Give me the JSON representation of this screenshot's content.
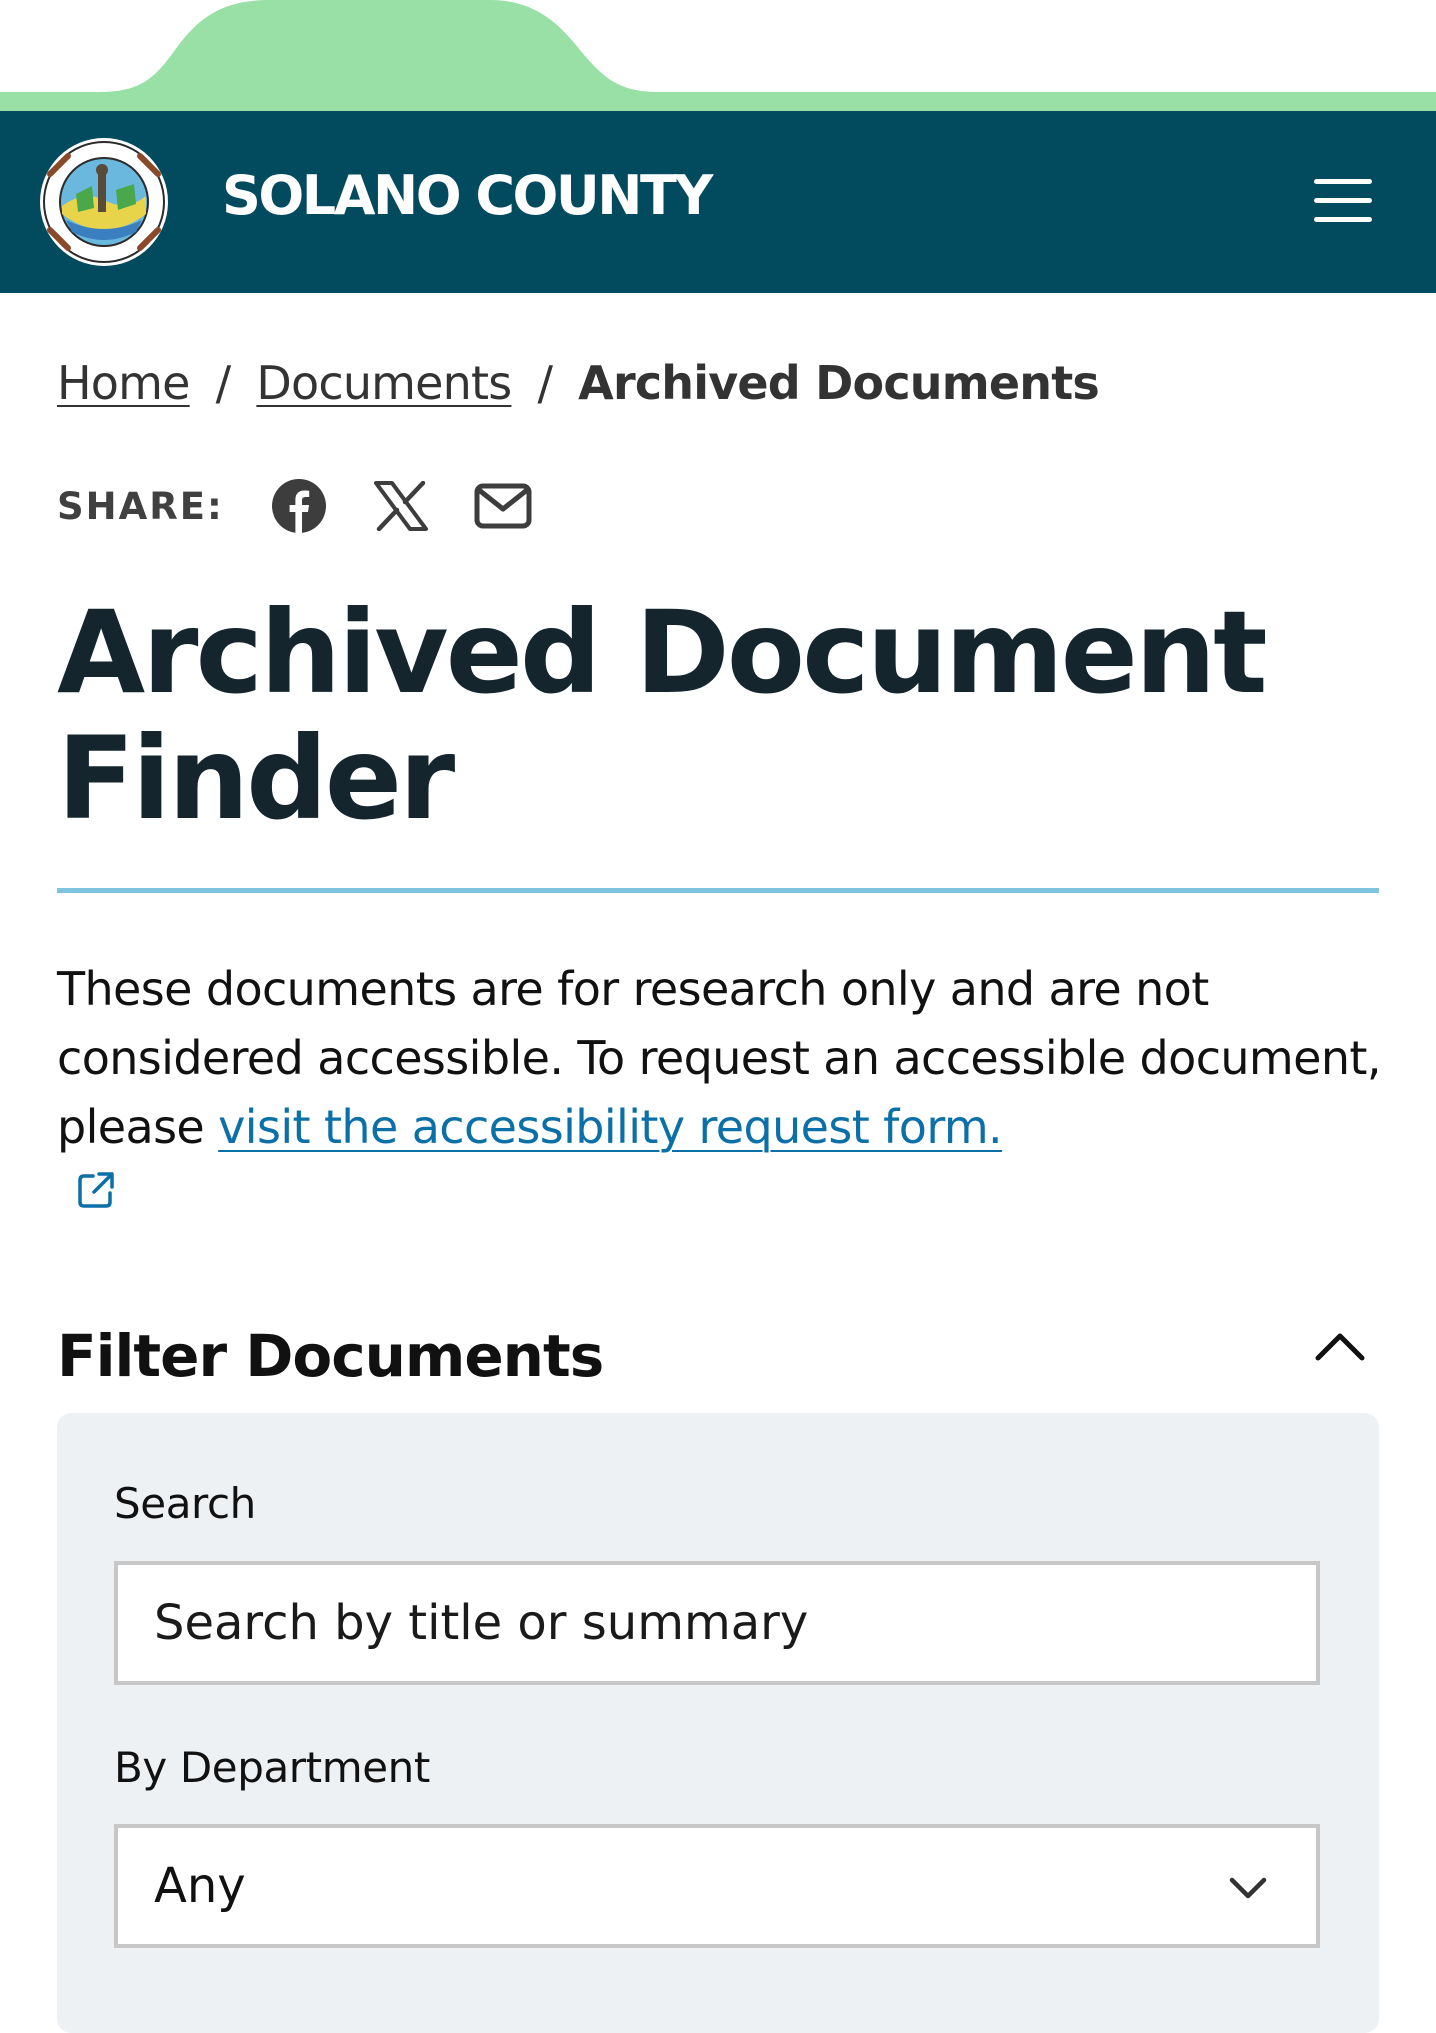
{
  "header": {
    "site_title": "SOLANO COUNTY",
    "seal_icon": "county-seal-icon",
    "menu_icon": "hamburger-menu-icon",
    "background_color": "#024a5e",
    "accent_green": "#98e0a6"
  },
  "breadcrumb": {
    "items": [
      {
        "label": "Home"
      },
      {
        "label": "Documents"
      },
      {
        "label": "Archived Documents"
      }
    ],
    "separator": "/"
  },
  "share": {
    "label": "SHARE:",
    "icons": [
      "facebook-icon",
      "x-icon",
      "email-icon"
    ]
  },
  "page": {
    "title": "Archived Document Finder",
    "intro_text": "These documents are for research only and are not considered accessible. To request an accessible document, please",
    "intro_link": "visit the accessibility request form.",
    "intro_link_icon": "external-link-icon",
    "link_color": "#0b6fa8",
    "rule_color": "#7fc4de"
  },
  "filter": {
    "heading": "Filter Documents",
    "toggle_icon": "chevron-up-icon",
    "search_label": "Search",
    "search_placeholder": "Search by title or summary",
    "search_value": "",
    "department_label": "By Department",
    "department_selected": "Any",
    "department_icon": "chevron-down-icon"
  }
}
